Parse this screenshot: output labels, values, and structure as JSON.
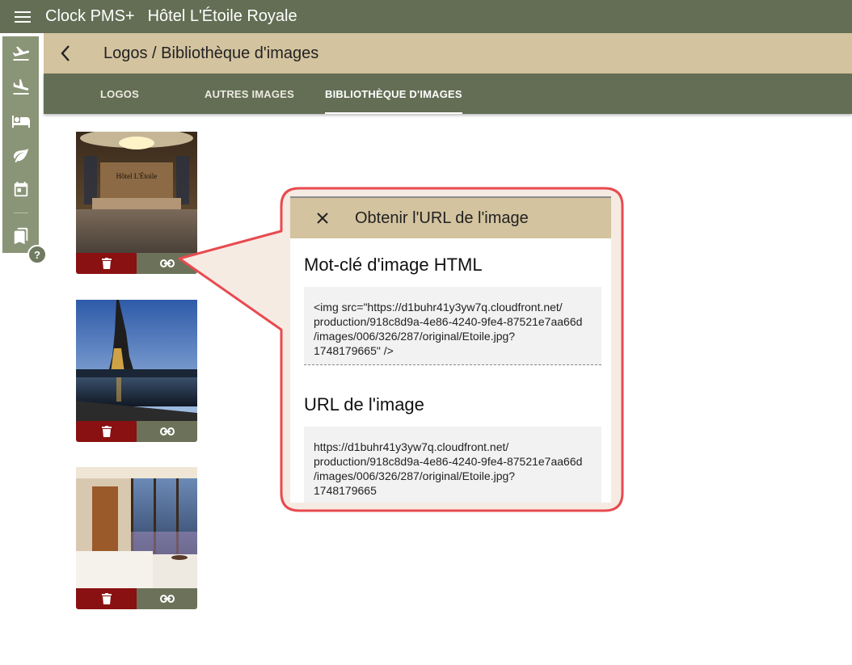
{
  "appbar": {
    "app_name": "Clock PMS+",
    "hotel_name": "Hôtel L'Étoile Royale"
  },
  "subheader": {
    "title": "Logos / Bibliothèque d'images"
  },
  "tabs": [
    {
      "label": "LOGOS",
      "active": false
    },
    {
      "label": "AUTRES IMAGES",
      "active": false
    },
    {
      "label": "BIBLIOTHÈQUE D'IMAGES",
      "active": true
    }
  ],
  "sidebar": {
    "items": [
      {
        "icon": "flight-takeoff-icon"
      },
      {
        "icon": "flight-land-icon"
      },
      {
        "icon": "hotel-bed-icon"
      },
      {
        "icon": "leaf-icon"
      },
      {
        "icon": "calendar-icon"
      },
      {
        "icon": "bookmarks-icon"
      }
    ],
    "help": "?"
  },
  "images": [
    {
      "subject": "hotel-lobby",
      "logo_text": "Hôtel L'Étoile"
    },
    {
      "subject": "eiffel-tower"
    },
    {
      "subject": "spa-room"
    }
  ],
  "dialog": {
    "title": "Obtenir l'URL de l'image",
    "html_tag_heading": "Mot-clé d'image HTML",
    "html_tag_value": "<img src=\"https://d1buhr41y3yw7q.cloudfront.net/\nproduction/918c8d9a-4e86-4240-9fe4-87521e7aa66d\n/images/006/326/287/original/Etoile.jpg?\n1748179665\" />",
    "url_heading": "URL de l'image",
    "url_value": "https://d1buhr41y3yw7q.cloudfront.net/\nproduction/918c8d9a-4e86-4240-9fe4-87521e7aa66d\n/images/006/326/287/original/Etoile.jpg?\n1748179665"
  },
  "colors": {
    "appbar": "#646e55",
    "header": "#d3c39f",
    "delete": "#8a1111",
    "link": "#6b7259",
    "callout_border": "#e84a4f",
    "callout_fill": "#f5ebe3"
  }
}
